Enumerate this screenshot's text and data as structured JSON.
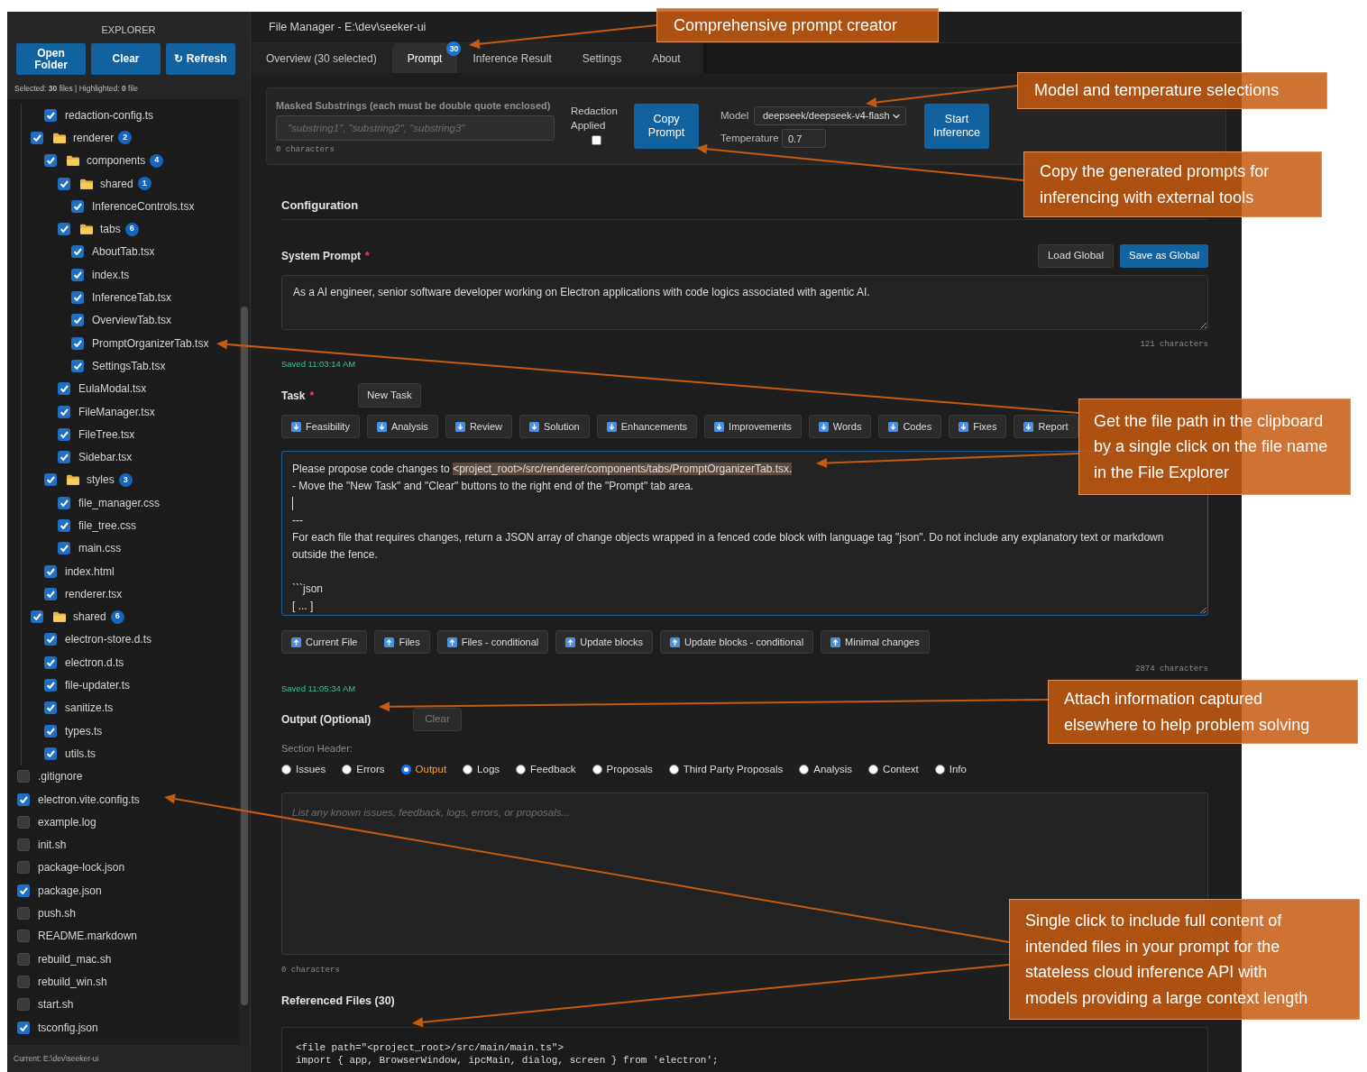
{
  "sidebar": {
    "title": "EXPLORER",
    "buttons": [
      "Open Folder",
      "Clear",
      "↻ Refresh"
    ],
    "status": "Selected: **30** files | Highlighted: **0** file",
    "tree": [
      {
        "children": [
          {
            "children": [
              {
                "kind": "file",
                "name": "redaction-config.ts",
                "checked": true
              }
            ]
          },
          {
            "kind": "folder",
            "name": "renderer",
            "checked": true,
            "count": "2",
            "children": [
              {
                "kind": "folder",
                "name": "components",
                "checked": true,
                "count": "4",
                "children": [
                  {
                    "kind": "folder",
                    "name": "shared",
                    "checked": true,
                    "count": "1",
                    "children": [
                      {
                        "kind": "file",
                        "name": "InferenceControls.tsx",
                        "checked": true
                      }
                    ]
                  },
                  {
                    "kind": "folder",
                    "name": "tabs",
                    "checked": true,
                    "count": "6",
                    "children": [
                      {
                        "kind": "file",
                        "name": "AboutTab.tsx",
                        "checked": true
                      },
                      {
                        "kind": "file",
                        "name": "index.ts",
                        "checked": true
                      },
                      {
                        "kind": "file",
                        "name": "InferenceTab.tsx",
                        "checked": true
                      },
                      {
                        "kind": "file",
                        "name": "OverviewTab.tsx",
                        "checked": true
                      },
                      {
                        "kind": "file",
                        "name": "PromptOrganizerTab.tsx",
                        "checked": true
                      },
                      {
                        "kind": "file",
                        "name": "SettingsTab.tsx",
                        "checked": true
                      }
                    ]
                  },
                  {
                    "kind": "file",
                    "name": "EulaModal.tsx",
                    "checked": true
                  },
                  {
                    "kind": "file",
                    "name": "FileManager.tsx",
                    "checked": true
                  },
                  {
                    "kind": "file",
                    "name": "FileTree.tsx",
                    "checked": true
                  },
                  {
                    "kind": "file",
                    "name": "Sidebar.tsx",
                    "checked": true
                  }
                ]
              },
              {
                "kind": "folder",
                "name": "styles",
                "checked": true,
                "count": "3",
                "children": [
                  {
                    "kind": "file",
                    "name": "file_manager.css",
                    "checked": true
                  },
                  {
                    "kind": "file",
                    "name": "file_tree.css",
                    "checked": true
                  },
                  {
                    "kind": "file",
                    "name": "main.css",
                    "checked": true
                  }
                ]
              },
              {
                "kind": "file",
                "name": "index.html",
                "checked": true
              },
              {
                "kind": "file",
                "name": "renderer.tsx",
                "checked": true
              }
            ]
          },
          {
            "kind": "folder",
            "name": "shared",
            "checked": true,
            "count": "6",
            "children": [
              {
                "kind": "file",
                "name": "electron-store.d.ts",
                "checked": true
              },
              {
                "kind": "file",
                "name": "electron.d.ts",
                "checked": true
              },
              {
                "kind": "file",
                "name": "file-updater.ts",
                "checked": true
              },
              {
                "kind": "file",
                "name": "sanitize.ts",
                "checked": true
              },
              {
                "kind": "file",
                "name": "types.ts",
                "checked": true
              },
              {
                "kind": "file",
                "name": "utils.ts",
                "checked": true
              }
            ]
          }
        ]
      },
      {
        "kind": "file",
        "name": ".gitignore",
        "checked": false
      },
      {
        "kind": "file",
        "name": "electron.vite.config.ts",
        "checked": true
      },
      {
        "kind": "file",
        "name": "example.log",
        "checked": false
      },
      {
        "kind": "file",
        "name": "init.sh",
        "checked": false
      },
      {
        "kind": "file",
        "name": "package-lock.json",
        "checked": false
      },
      {
        "kind": "file",
        "name": "package.json",
        "checked": true
      },
      {
        "kind": "file",
        "name": "push.sh",
        "checked": false
      },
      {
        "kind": "file",
        "name": "README.markdown",
        "checked": false
      },
      {
        "kind": "file",
        "name": "rebuild_mac.sh",
        "checked": false
      },
      {
        "kind": "file",
        "name": "rebuild_win.sh",
        "checked": false
      },
      {
        "kind": "file",
        "name": "start.sh",
        "checked": false
      },
      {
        "kind": "file",
        "name": "tsconfig.json",
        "checked": true
      }
    ],
    "footer": "Current: E:\\dev\\seeker-ui"
  },
  "window": {
    "title": "File Manager - E:\\dev\\seeker-ui"
  },
  "tabs": [
    {
      "label": "Overview (30 selected)",
      "selected": false
    },
    {
      "label": "Prompt",
      "selected": true,
      "badge": "30"
    },
    {
      "label": "Inference Result",
      "selected": false
    },
    {
      "label": "Settings",
      "selected": false
    },
    {
      "label": "About",
      "selected": false
    }
  ],
  "toolbar": {
    "masked": {
      "label": "Masked Substrings (each must be double quote enclosed)",
      "placeholder": "\"substring1\", \"substring2\", \"substring3\"",
      "count": "0 characters"
    },
    "redaction": {
      "label": "Redaction Applied",
      "checked": false
    },
    "copy_button": "Copy Prompt",
    "model": {
      "label": "Model",
      "value": "deepseek/deepseek-v4-flash"
    },
    "temperature": {
      "label": "Temperature",
      "value": "0.7"
    },
    "start_button": "Start Inference"
  },
  "configuration": {
    "title": "Configuration"
  },
  "system_prompt": {
    "label": "System Prompt",
    "required_mark": "*",
    "buttons": [
      {
        "label": "Load Global",
        "primary": false
      },
      {
        "label": "Save as Global",
        "primary": true
      }
    ],
    "value": "As a AI engineer, senior software developer working on Electron applications with code logics associated with agentic AI.",
    "count": "121 characters",
    "saved": "Saved 11:03:14 AM"
  },
  "task": {
    "label": "Task",
    "required_mark": "*",
    "new_task_button": "New Task",
    "templates": [
      "Feasibility",
      "Analysis",
      "Review",
      "Solution",
      "Enhancements",
      "Improvements",
      "Words",
      "Codes",
      "Fixes",
      "Report"
    ],
    "focused": true,
    "value": {
      "before": "Please propose code changes to ",
      "highlighted": "<project_root>/src/renderer/components/tabs/PromptOrganizerTab.tsx.",
      "before_caret": "\n- Move the \"New Task\" and \"Clear\" buttons to the right end of the \"Prompt\" tab area.\n",
      "after_caret": "\n---\nFor each file that requires changes, return a JSON array of change objects wrapped in a fenced code block with language tag \"json\". Do not include any explanatory text or markdown outside the fence.\n\n```json\n[ ... ]"
    },
    "insert_buttons": [
      "Current File",
      "Files",
      "Files - conditional",
      "Update blocks",
      "Update blocks - conditional",
      "Minimal changes"
    ],
    "count": "2874 characters",
    "saved": "Saved 11:05:34 AM"
  },
  "output": {
    "label": "Output (Optional)",
    "clear_button": {
      "label": "Clear",
      "disabled": true
    },
    "section_header": "Section Header:",
    "options": [
      {
        "label": "Issues",
        "selected": false
      },
      {
        "label": "Errors",
        "selected": false
      },
      {
        "label": "Output",
        "selected": true
      },
      {
        "label": "Logs",
        "selected": false
      },
      {
        "label": "Feedback",
        "selected": false
      },
      {
        "label": "Proposals",
        "selected": false
      },
      {
        "label": "Third Party Proposals",
        "selected": false
      },
      {
        "label": "Analysis",
        "selected": false
      },
      {
        "label": "Context",
        "selected": false
      },
      {
        "label": "Info",
        "selected": false
      }
    ],
    "placeholder": "List any known issues, feedback, logs, errors, or proposals...",
    "count": "0 characters"
  },
  "referenced_files": {
    "title": "Referenced Files (30)",
    "code_lines": [
      "<file path=\"<project_root>/src/main/main.ts\">",
      "import { app, BrowserWindow, ipcMain, dialog, screen } from 'electron';"
    ]
  },
  "callouts": [
    {
      "text": "Comprehensive prompt creator"
    },
    {
      "text": "Model and temperature selections"
    },
    {
      "text": "Copy the generated prompts for inferencing with external tools"
    },
    {
      "text": "Get the file path in the clipboard by a single click on the file name in the File Explorer"
    },
    {
      "text": "Attach information captured elsewhere to help problem solving"
    },
    {
      "text": "Single click to include full content of intended files in your prompt for the stateless cloud inference API with models providing a large context length"
    }
  ]
}
